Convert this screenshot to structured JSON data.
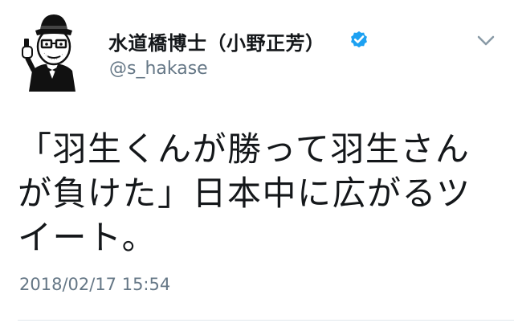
{
  "user": {
    "display_name": "水道橋博士（小野正芳）",
    "handle": "@s_hakase",
    "verified": true
  },
  "tweet": {
    "text": "「羽生くんが勝って羽生さんが負けた」日本中に広がるツイート。",
    "timestamp": "2018/02/17 15:54"
  },
  "icons": {
    "verified": "verified-check-icon",
    "menu": "chevron-down-icon"
  },
  "colors": {
    "verified_blue": "#1DA1F2",
    "secondary_text": "#657786",
    "primary_text": "#14171A",
    "divider": "#E1E8ED"
  }
}
